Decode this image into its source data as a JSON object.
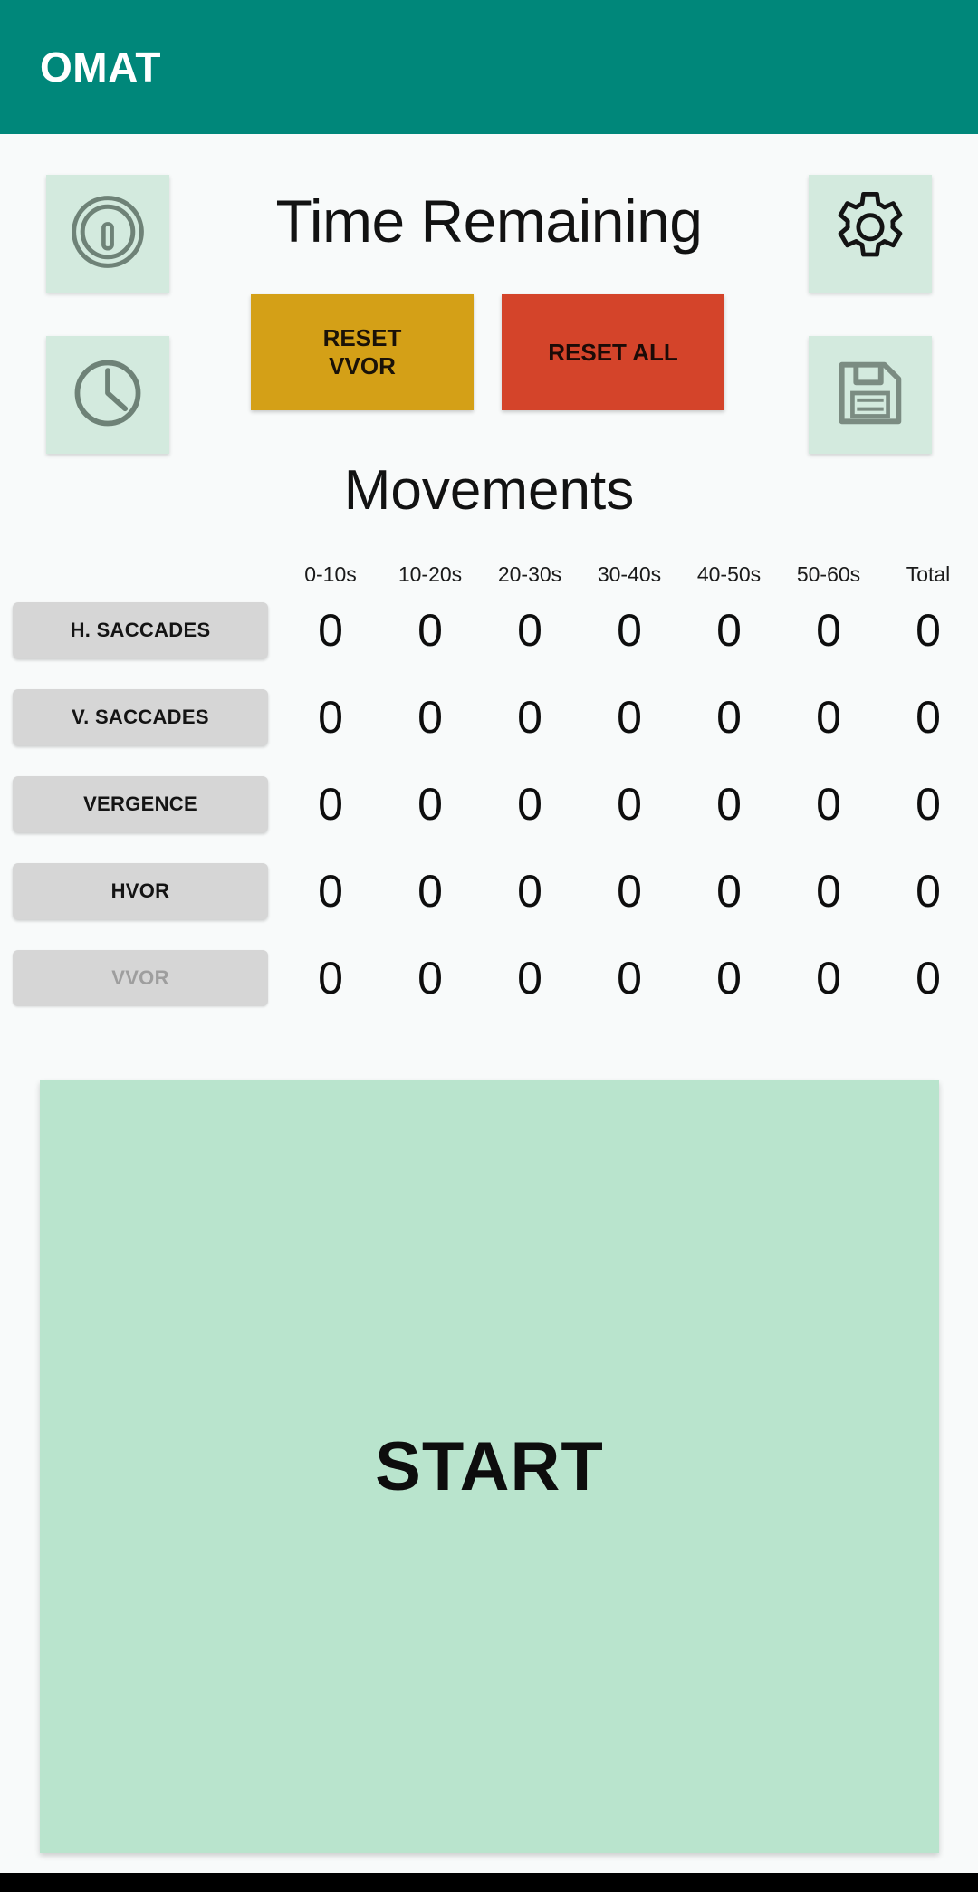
{
  "app": {
    "title": "OMAT",
    "brand_color": "#00877a",
    "background": "#f8fafa"
  },
  "toolbar": {
    "info_icon": "info-circle-icon",
    "clock_icon": "clock-icon",
    "settings_icon": "gear-icon",
    "save_icon": "floppy-disk-save-icon",
    "icon_tile_color": "#d3eade"
  },
  "headings": {
    "time_remaining": "Time Remaining",
    "movements": "Movements"
  },
  "reset": {
    "vvor_label": "RESET\nVVOR",
    "vvor_color": "#d4a017",
    "all_label": "RESET ALL",
    "all_color": "#d4442a"
  },
  "table": {
    "columns": [
      "0-10s",
      "10-20s",
      "20-30s",
      "30-40s",
      "40-50s",
      "50-60s",
      "Total"
    ],
    "rows": [
      {
        "label": "H. SACCADES",
        "disabled": false,
        "values": [
          "0",
          "0",
          "0",
          "0",
          "0",
          "0",
          "0"
        ]
      },
      {
        "label": "V. SACCADES",
        "disabled": false,
        "values": [
          "0",
          "0",
          "0",
          "0",
          "0",
          "0",
          "0"
        ]
      },
      {
        "label": "VERGENCE",
        "disabled": false,
        "values": [
          "0",
          "0",
          "0",
          "0",
          "0",
          "0",
          "0"
        ]
      },
      {
        "label": "HVOR",
        "disabled": false,
        "values": [
          "0",
          "0",
          "0",
          "0",
          "0",
          "0",
          "0"
        ]
      },
      {
        "label": "VVOR",
        "disabled": true,
        "values": [
          "0",
          "0",
          "0",
          "0",
          "0",
          "0",
          "0"
        ]
      }
    ]
  },
  "start": {
    "label": "START",
    "color": "#b9e4cd"
  }
}
